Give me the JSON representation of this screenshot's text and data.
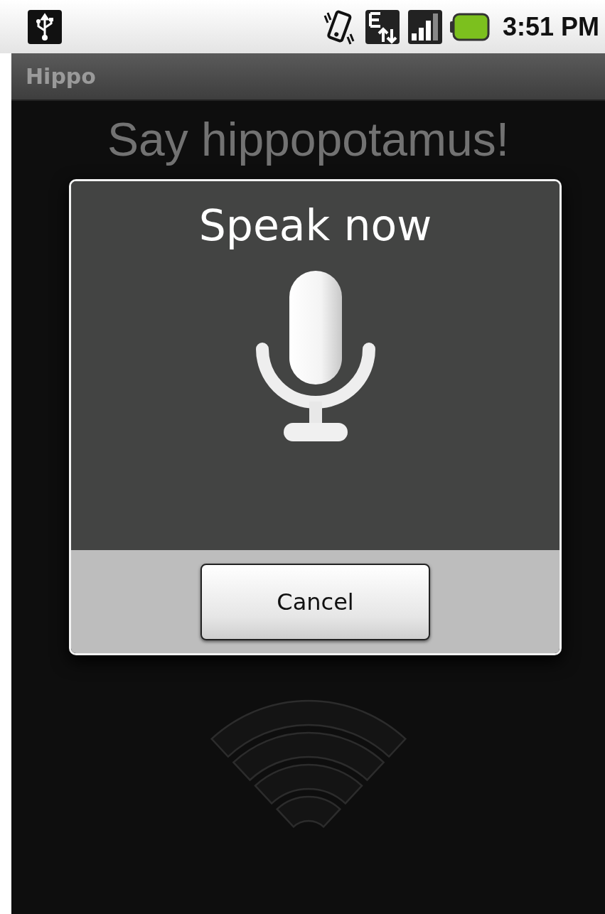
{
  "status_bar": {
    "time": "3:51 PM"
  },
  "app_bar": {
    "title": "Hippo"
  },
  "prompt": "Say hippopotamus!",
  "dialog": {
    "title": "Speak now",
    "buttons": [
      "Cancel"
    ]
  }
}
